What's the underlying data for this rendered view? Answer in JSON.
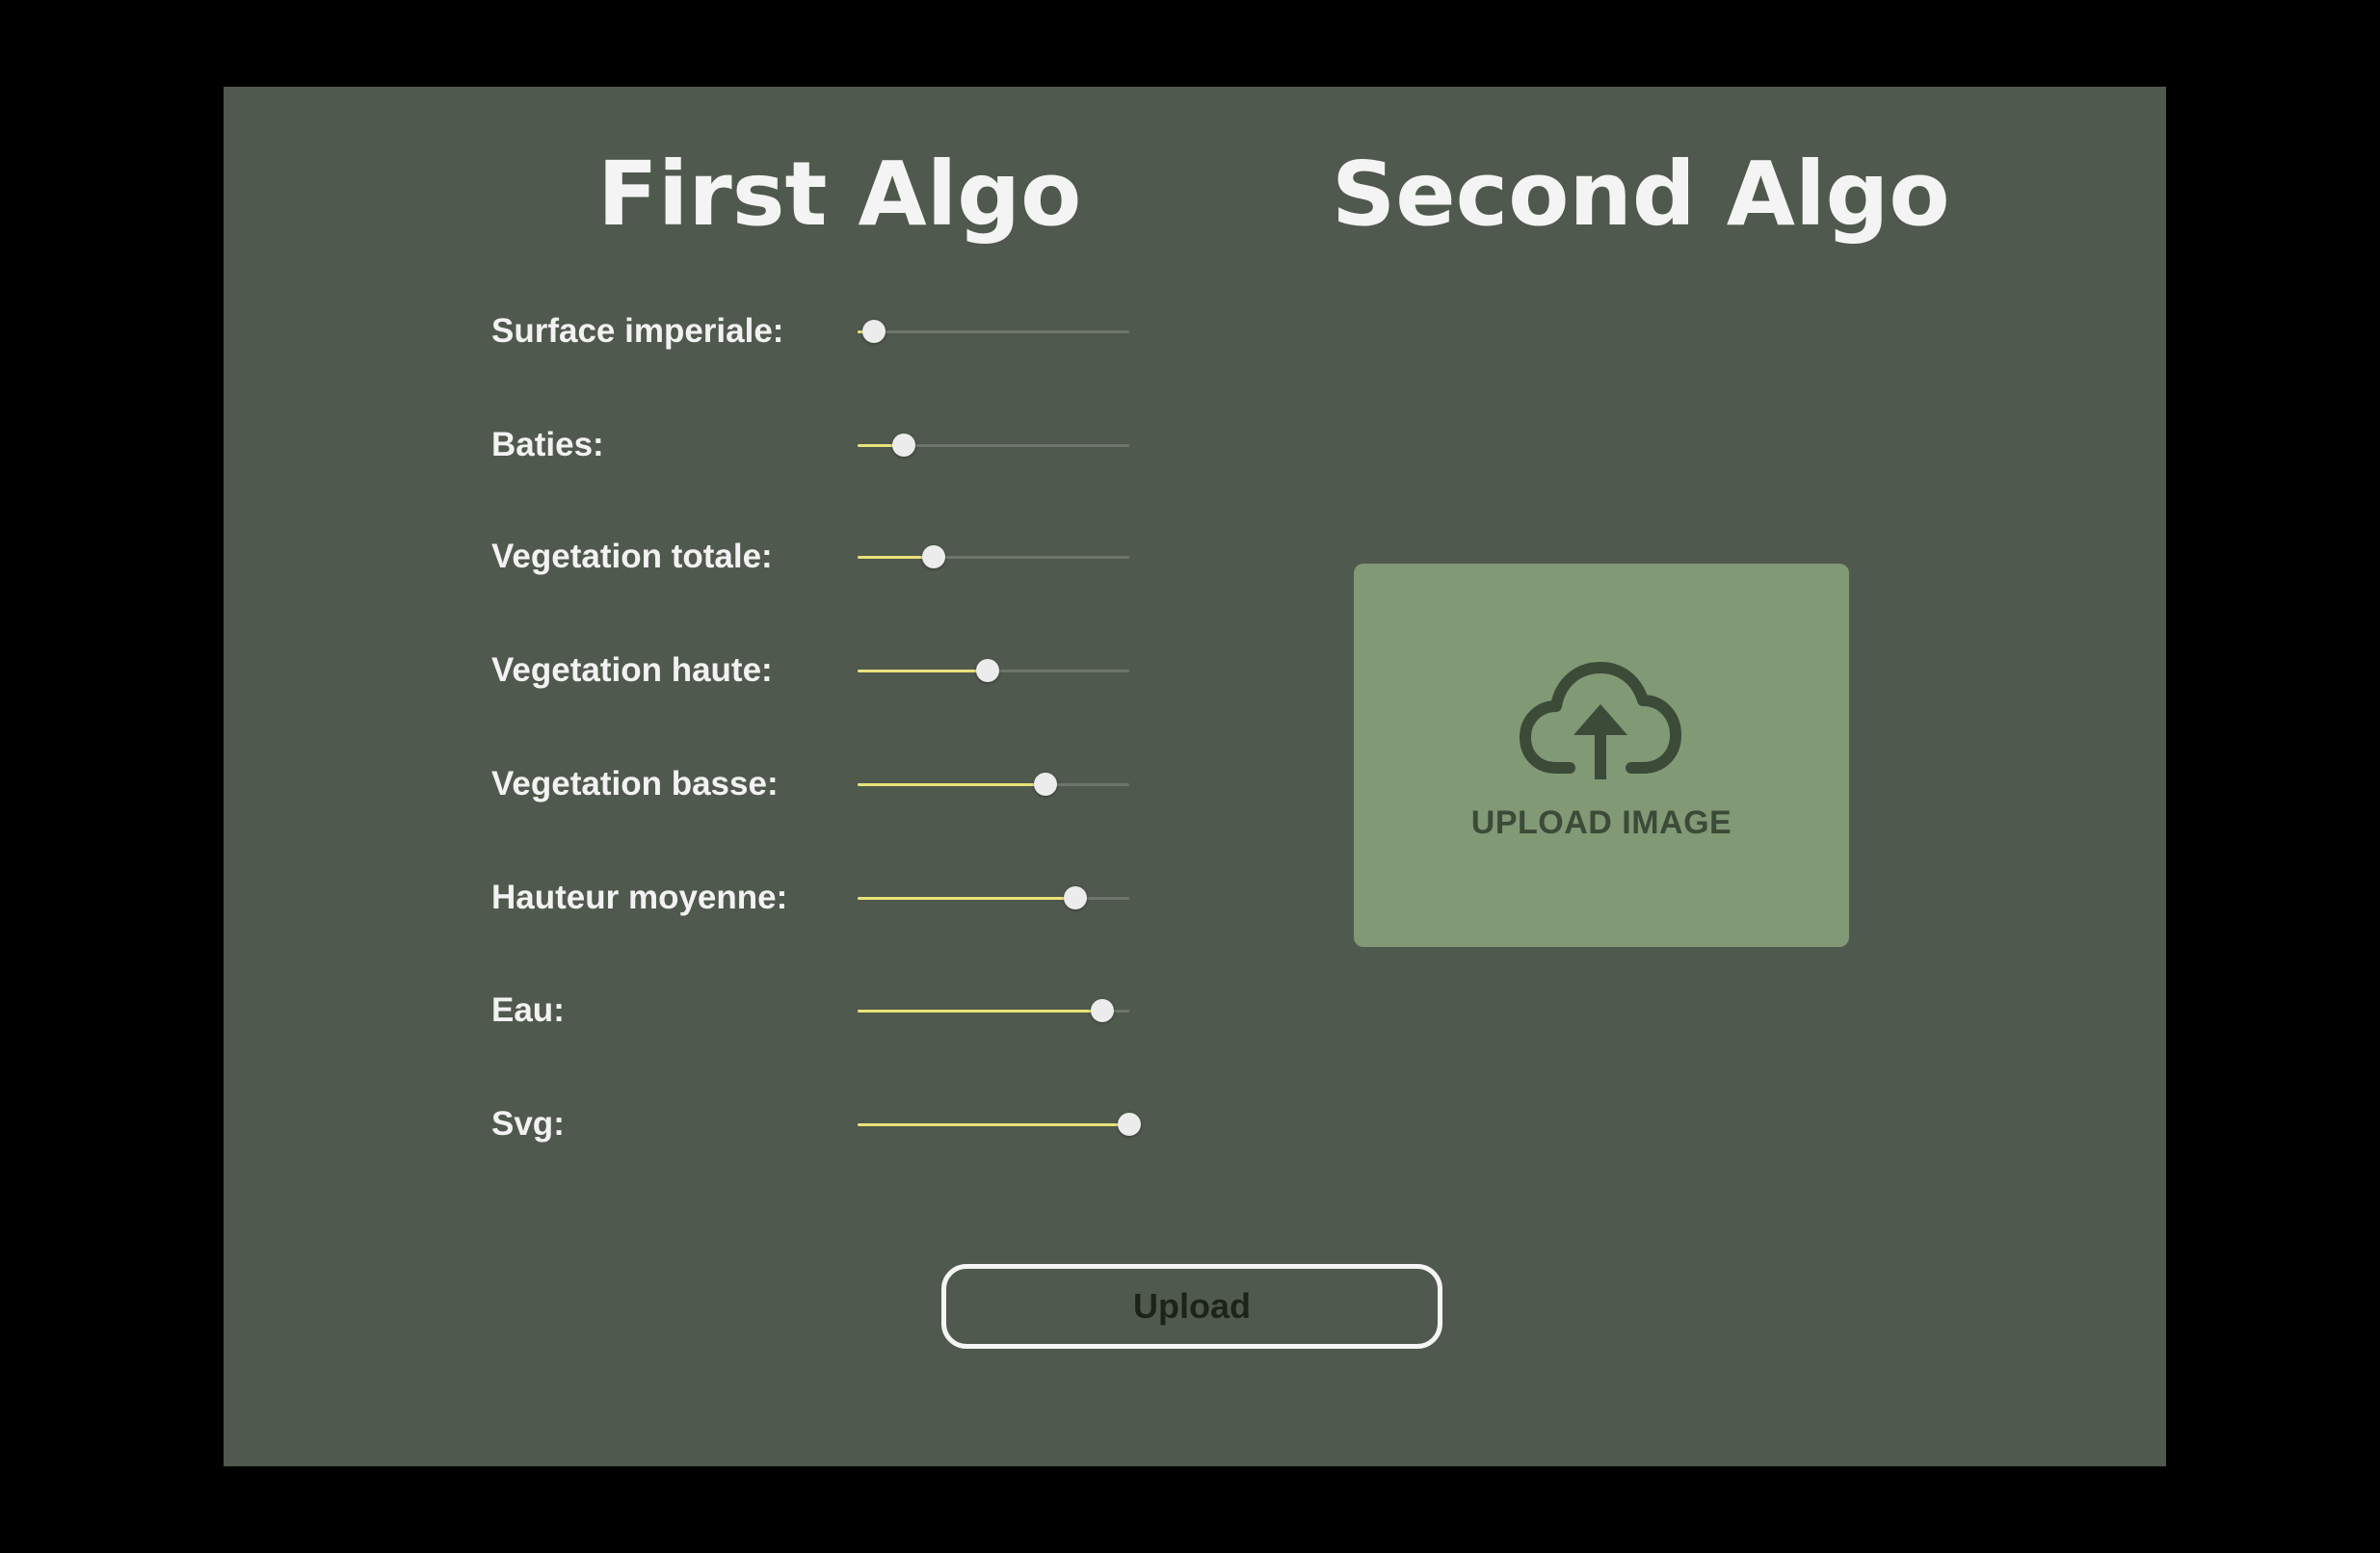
{
  "headings": {
    "first": "First Algo",
    "second": "Second Algo"
  },
  "sliders": [
    {
      "label": "Surface imperiale:",
      "value": 0.06
    },
    {
      "label": "Baties:",
      "value": 0.17
    },
    {
      "label": "Vegetation totale:",
      "value": 0.28
    },
    {
      "label": "Vegetation haute:",
      "value": 0.48
    },
    {
      "label": "Vegetation basse:",
      "value": 0.69
    },
    {
      "label": "Hauteur moyenne:",
      "value": 0.8
    },
    {
      "label": "Eau:",
      "value": 0.9
    },
    {
      "label": "Svg:",
      "value": 1.0
    }
  ],
  "upload_area": {
    "label": "UPLOAD IMAGE",
    "icon": "cloud-upload-icon"
  },
  "upload_button": {
    "label": "Upload"
  },
  "colors": {
    "background": "#000000",
    "panel": "#50594d",
    "slider_fill": "#e9e27a",
    "slider_track": "#6e756c",
    "slider_thumb": "#ececec",
    "upload_box": "#819975",
    "upload_content": "#3c4a38"
  }
}
